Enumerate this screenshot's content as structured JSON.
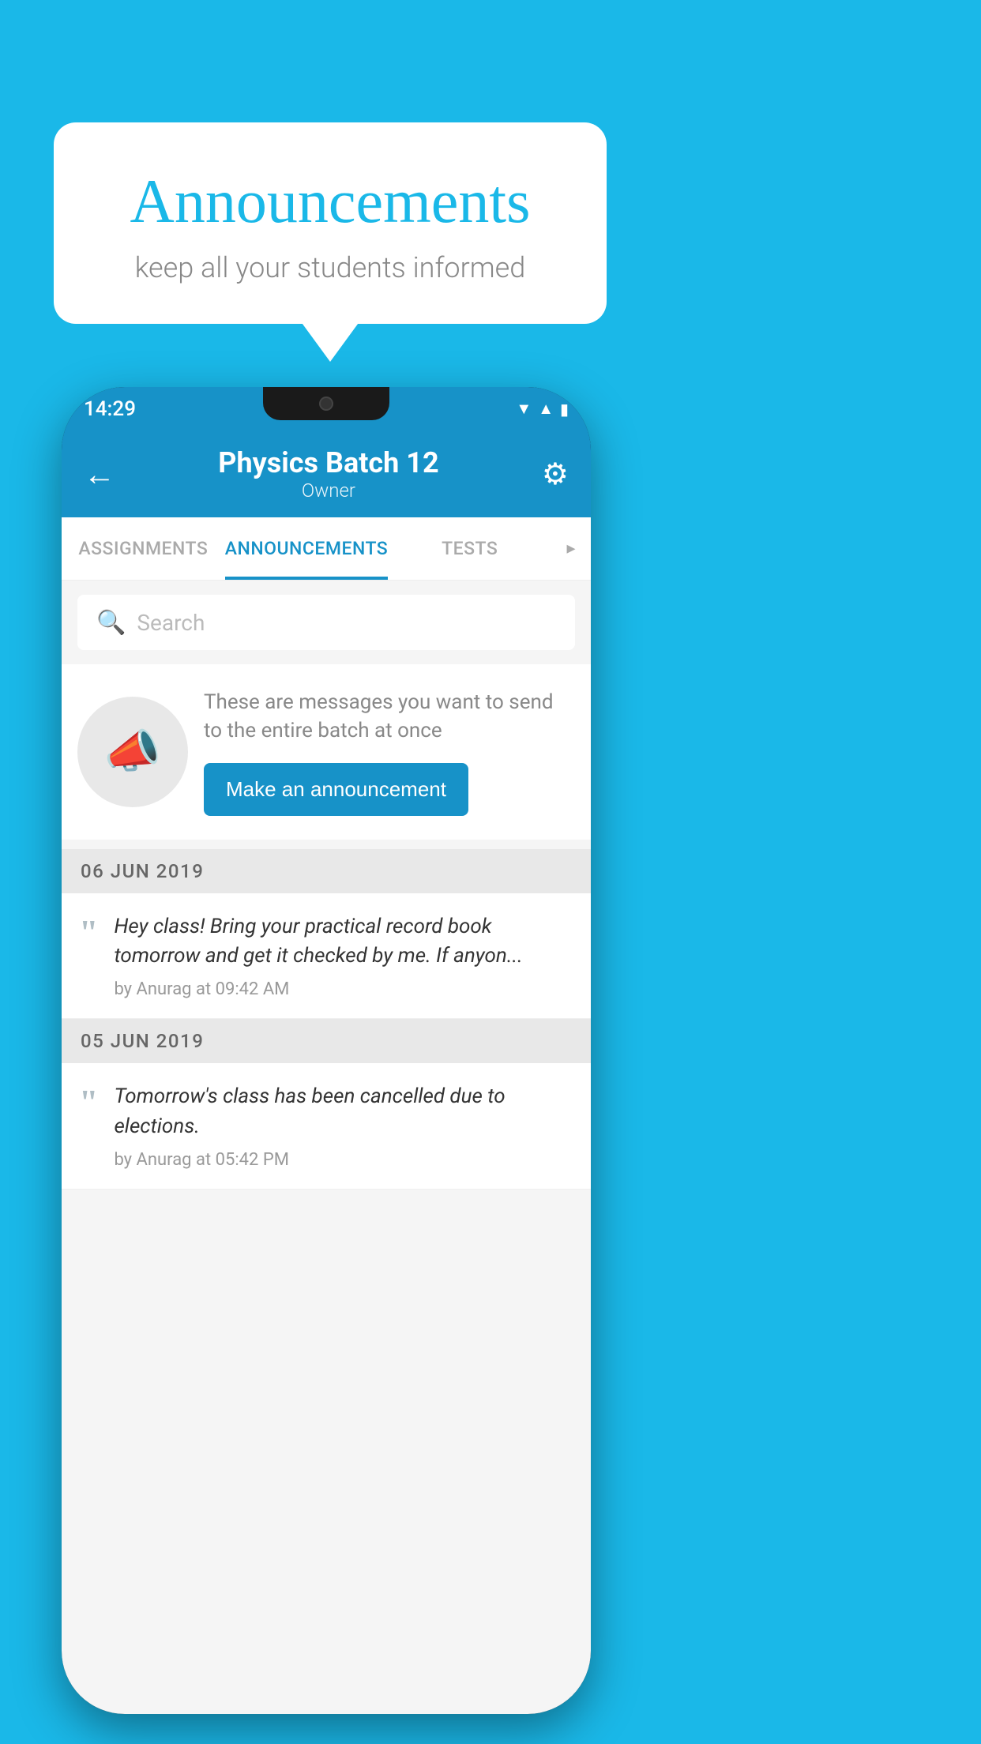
{
  "background": {
    "color": "#1ab8e8"
  },
  "speech_bubble": {
    "title": "Announcements",
    "subtitle": "keep all your students informed"
  },
  "phone": {
    "status_bar": {
      "time": "14:29",
      "icons": [
        "wifi",
        "signal",
        "battery"
      ]
    },
    "app_bar": {
      "title": "Physics Batch 12",
      "subtitle": "Owner",
      "back_label": "←",
      "settings_label": "⚙"
    },
    "tabs": [
      {
        "label": "ASSIGNMENTS",
        "active": false
      },
      {
        "label": "ANNOUNCEMENTS",
        "active": true
      },
      {
        "label": "TESTS",
        "active": false
      }
    ],
    "search": {
      "placeholder": "Search"
    },
    "promo": {
      "description": "These are messages you want to send to the entire batch at once",
      "button_label": "Make an announcement"
    },
    "announcements": [
      {
        "date": "06  JUN  2019",
        "message": "Hey class! Bring your practical record book tomorrow and get it checked by me. If anyon...",
        "by": "by Anurag at 09:42 AM"
      },
      {
        "date": "05  JUN  2019",
        "message": "Tomorrow's class has been cancelled due to elections.",
        "by": "by Anurag at 05:42 PM"
      }
    ]
  }
}
